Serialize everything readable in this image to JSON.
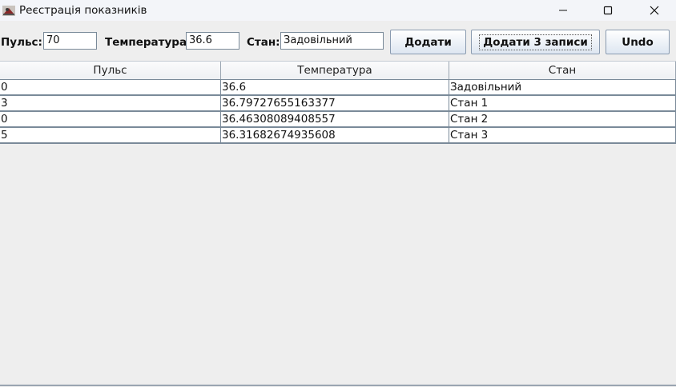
{
  "window": {
    "title": "Реєстрація показників"
  },
  "form": {
    "pulse_label": "Пульс:",
    "pulse_value": "70",
    "temp_label": "Температура:",
    "temp_value": "36.6",
    "state_label": "Стан:",
    "state_value": "Задовільний"
  },
  "buttons": {
    "add": "Додати",
    "add3": "Додати 3 записи",
    "undo": "Undo"
  },
  "table": {
    "columns": [
      "Пульс",
      "Температура",
      "Стан"
    ],
    "rows": [
      [
        "0",
        "36.6",
        "Задовільний"
      ],
      [
        "3",
        "36.79727655163377",
        "Стан 1"
      ],
      [
        "0",
        "36.46308089408557",
        "Стан 2"
      ],
      [
        "5",
        "36.31682674935608",
        "Стан 3"
      ]
    ]
  }
}
